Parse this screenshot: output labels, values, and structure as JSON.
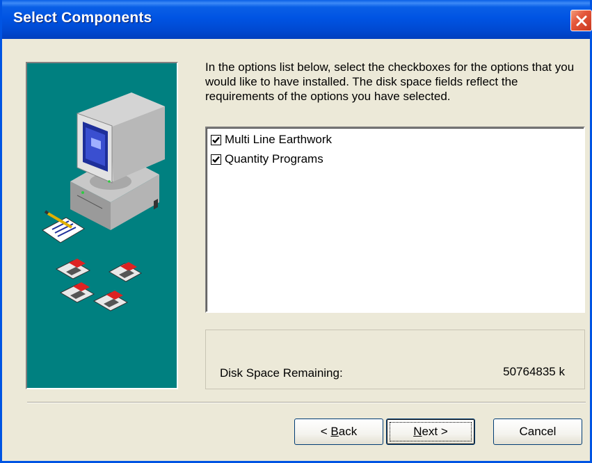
{
  "window": {
    "title": "Select Components"
  },
  "instructions": "In the options list below, select the checkboxes for the options that you would like to have installed.  The disk space fields reflect the requirements of the options you have selected.",
  "options": [
    {
      "label": "Multi Line Earthwork",
      "checked": true
    },
    {
      "label": "Quantity Programs",
      "checked": true
    }
  ],
  "disk_space": {
    "label": "Disk Space Remaining:",
    "value": "50764835 k"
  },
  "buttons": {
    "back_mnemonic": "B",
    "back_rest": "ack",
    "back_prefix": "< ",
    "next_mnemonic": "N",
    "next_rest": "ext >",
    "cancel": "Cancel"
  },
  "colors": {
    "titlebar": "#0054e3",
    "side_panel": "#008080",
    "dialog": "#ece9d8"
  }
}
